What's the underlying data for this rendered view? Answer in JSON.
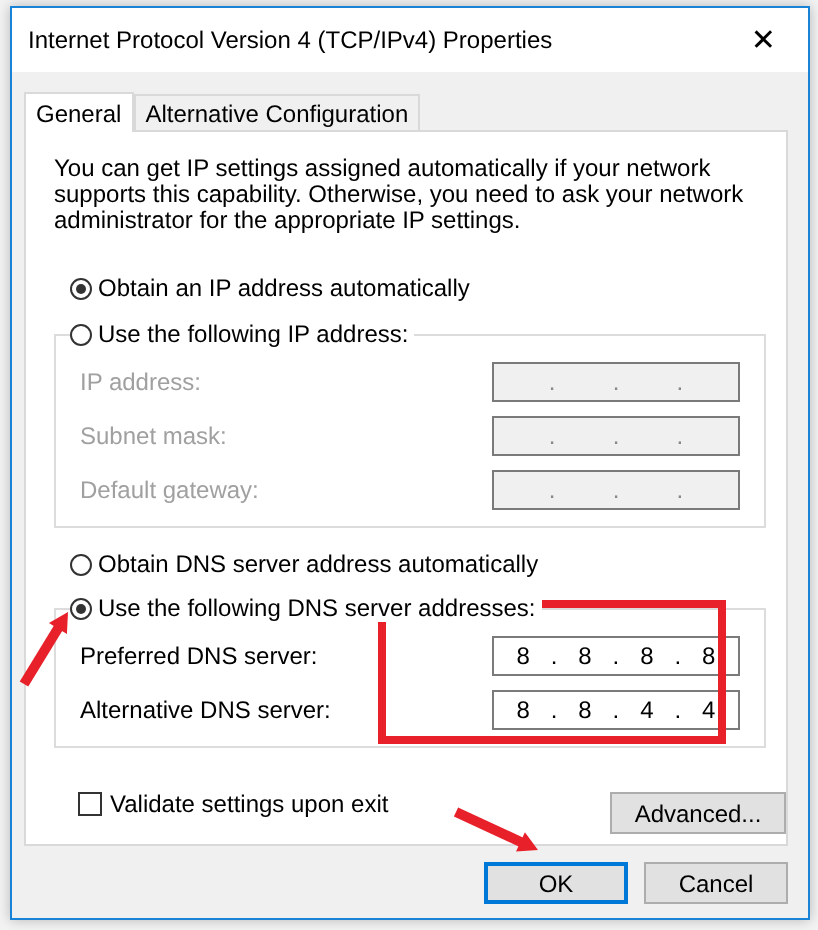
{
  "window": {
    "title": "Internet Protocol Version 4 (TCP/IPv4) Properties",
    "close": "✕"
  },
  "tabs": [
    {
      "label": "General",
      "selected": true
    },
    {
      "label": "Alternative Configuration",
      "selected": false
    }
  ],
  "description": "You can get IP settings assigned automatically if your network supports this capability. Otherwise, you need to ask your network administrator for the appropriate IP settings.",
  "ip_separator": ".",
  "ip_mode": [
    {
      "label": "Obtain an IP address automatically",
      "selected": true
    },
    {
      "label": "Use the following IP address:",
      "selected": false
    }
  ],
  "ip_fields": [
    {
      "label": "IP address:",
      "disabled": true
    },
    {
      "label": "Subnet mask:",
      "disabled": true
    },
    {
      "label": "Default gateway:",
      "disabled": true
    }
  ],
  "dns_mode": [
    {
      "label": "Obtain DNS server address automatically",
      "selected": false
    },
    {
      "label": "Use the following DNS server addresses:",
      "selected": true
    }
  ],
  "dns_fields": [
    {
      "label": "Preferred DNS server:",
      "disabled": false,
      "octets": [
        "8",
        "8",
        "8",
        "8"
      ]
    },
    {
      "label": "Alternative DNS server:",
      "disabled": false,
      "octets": [
        "8",
        "8",
        "4",
        "4"
      ]
    }
  ],
  "validate": {
    "label": "Validate settings upon exit",
    "checked": false
  },
  "advanced_button": "Advanced...",
  "buttons": [
    {
      "label": "OK",
      "default": true
    },
    {
      "label": "Cancel",
      "default": false
    }
  ]
}
